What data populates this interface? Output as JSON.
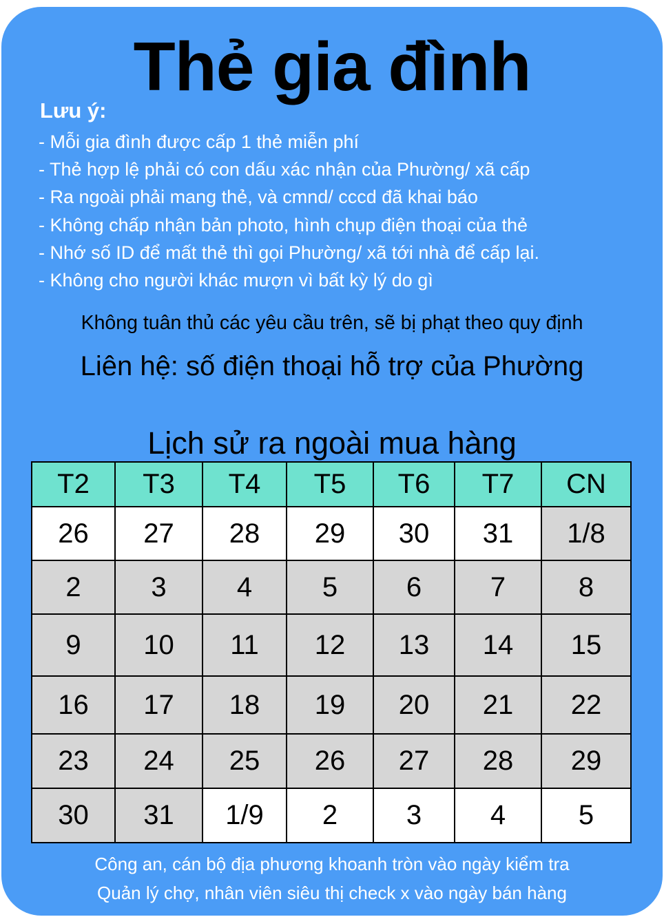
{
  "title": "Thẻ gia đình",
  "notes": {
    "heading": "Lưu ý:",
    "items": [
      "- Mỗi gia đình được cấp 1 thẻ miễn phí",
      "- Thẻ hợp lệ phải có con dấu xác nhận của Phường/ xã cấp",
      "- Ra ngoài phải mang thẻ, và cmnd/ cccd đã khai báo",
      "- Không chấp nhận bản photo, hình chụp điện thoại của thẻ",
      "- Nhớ số ID để mất thẻ thì gọi Phường/ xã tới nhà để cấp lại.",
      "- Không cho người khác mượn vì bất kỳ lý do gì"
    ]
  },
  "warning": "Không tuân thủ các yêu cầu trên, sẽ bị phạt theo quy định",
  "contact": "Liên hệ: số điện thoại hỗ trợ của Phường",
  "history": {
    "title": "Lịch sử ra ngoài mua hàng",
    "headers": [
      "T2",
      "T3",
      "T4",
      "T5",
      "T6",
      "T7",
      "CN"
    ],
    "rows": [
      [
        "26",
        "27",
        "28",
        "29",
        "30",
        "31",
        "1/8"
      ],
      [
        "2",
        "3",
        "4",
        "5",
        "6",
        "7",
        "8"
      ],
      [
        "9",
        "10",
        "11",
        "12",
        "13",
        "14",
        "15"
      ],
      [
        "16",
        "17",
        "18",
        "19",
        "20",
        "21",
        "22"
      ],
      [
        "23",
        "24",
        "25",
        "26",
        "27",
        "28",
        "29"
      ],
      [
        "30",
        "31",
        "1/9",
        "2",
        "3",
        "4",
        "5"
      ]
    ],
    "cell_colors": [
      [
        "white",
        "white",
        "white",
        "white",
        "white",
        "white",
        "gray"
      ],
      [
        "gray",
        "gray",
        "gray",
        "gray",
        "gray",
        "gray",
        "gray"
      ],
      [
        "gray",
        "gray",
        "gray",
        "gray",
        "gray",
        "gray",
        "gray"
      ],
      [
        "gray",
        "gray",
        "gray",
        "gray",
        "gray",
        "gray",
        "gray"
      ],
      [
        "gray",
        "gray",
        "gray",
        "gray",
        "gray",
        "gray",
        "gray"
      ],
      [
        "gray",
        "gray",
        "white",
        "white",
        "white",
        "white",
        "white"
      ]
    ]
  },
  "footer": {
    "line1": "Công an, cán bộ địa phương khoanh tròn vào ngày kiểm tra",
    "line2": "Quản lý chợ, nhân viên siêu thị check x vào ngày bán hàng"
  },
  "colors": {
    "card_background": "#4b9cf6",
    "header_cells": "#6fe2cf",
    "past_days": "#d6d6d6",
    "future_days": "#ffffff"
  }
}
